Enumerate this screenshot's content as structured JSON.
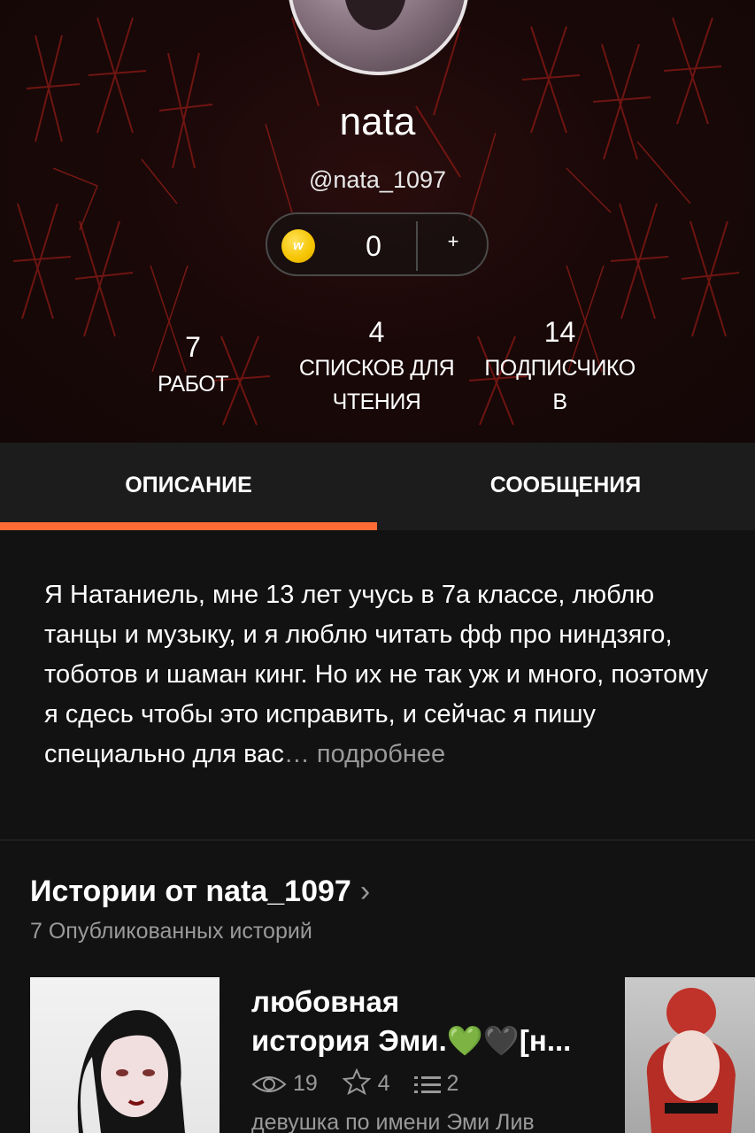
{
  "profile": {
    "display_name": "nata",
    "handle": "@nata_1097",
    "coins": {
      "count": "0",
      "add_label": "+",
      "icon": "coin-icon",
      "icon_letter": "w"
    },
    "stats": [
      {
        "value": "7",
        "label": "РАБОТ"
      },
      {
        "value": "4",
        "label_line1": "СПИСКОВ ДЛЯ",
        "label_line2": "ЧТЕНИЯ"
      },
      {
        "value": "14",
        "label_line1": "ПОДПИСЧИКО",
        "label_line2": "В"
      }
    ]
  },
  "tabs": [
    {
      "label": "ОПИСАНИЕ",
      "active": true
    },
    {
      "label": "СООБЩЕНИЯ",
      "active": false
    }
  ],
  "description": {
    "text": "Я Натаниель, мне 13 лет учусь в 7а классе, люблю танцы и музыку, и я люблю читать фф про ниндзяго, тоботов и шаман кинг. Но их не так уж и много, поэтому я сдесь чтобы это исправить, и сейчас я пишу специально для вас",
    "ellipsis": "…",
    "more_label": "подробнее"
  },
  "stories": {
    "title": "Истории от nata_1097",
    "chevron": "›",
    "subtitle": "7 Опубликованных историй",
    "items": [
      {
        "title_line1": "любовная",
        "title_line2": "история Эми.💚🖤[н...",
        "views": "19",
        "votes": "4",
        "parts": "2",
        "snippet": "девушка по имени Эми Лив"
      }
    ]
  },
  "colors": {
    "accent": "#ff6b35",
    "background": "#121212",
    "tab_bar": "#1c1c1c",
    "muted_text": "#9a9a9a"
  }
}
